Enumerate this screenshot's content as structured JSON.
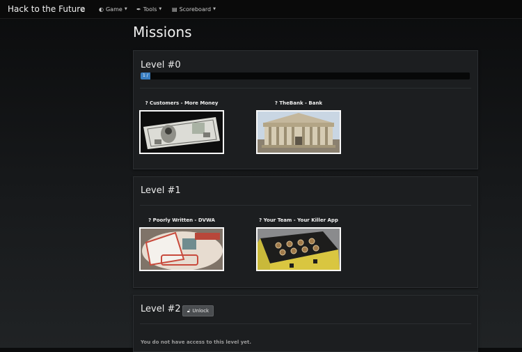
{
  "navbar": {
    "brand": "Hack to the Future",
    "items": [
      {
        "label": "",
        "icon": "home-icon"
      },
      {
        "label": "Game",
        "icon": "gamepad-icon"
      },
      {
        "label": "Tools",
        "icon": "wrench-icon"
      },
      {
        "label": "Scoreboard",
        "icon": "chart-icon"
      }
    ]
  },
  "page": {
    "title": "Missions"
  },
  "levels": [
    {
      "title": "Level #0",
      "progress": {
        "label": "1 /",
        "fraction": 0.03
      },
      "missions": [
        {
          "title": "? Customers - More Money",
          "image": "money-bill-image"
        },
        {
          "title": "? TheBank - Bank",
          "image": "bank-building-image"
        }
      ]
    },
    {
      "title": "Level #1",
      "missions": [
        {
          "title": "? Poorly Written - DVWA",
          "image": "dvwa-sticker-image"
        },
        {
          "title": "? Your Team - Your Killer App",
          "image": "killer-app-device-image"
        }
      ]
    },
    {
      "title": "Level #2",
      "unlock_label": "Unlock",
      "notice": "You do not have access to this level yet."
    }
  ],
  "colors": {
    "accent": "#3a7fc2",
    "panel": "#1c1e20",
    "navbar": "#0a0a0a"
  }
}
